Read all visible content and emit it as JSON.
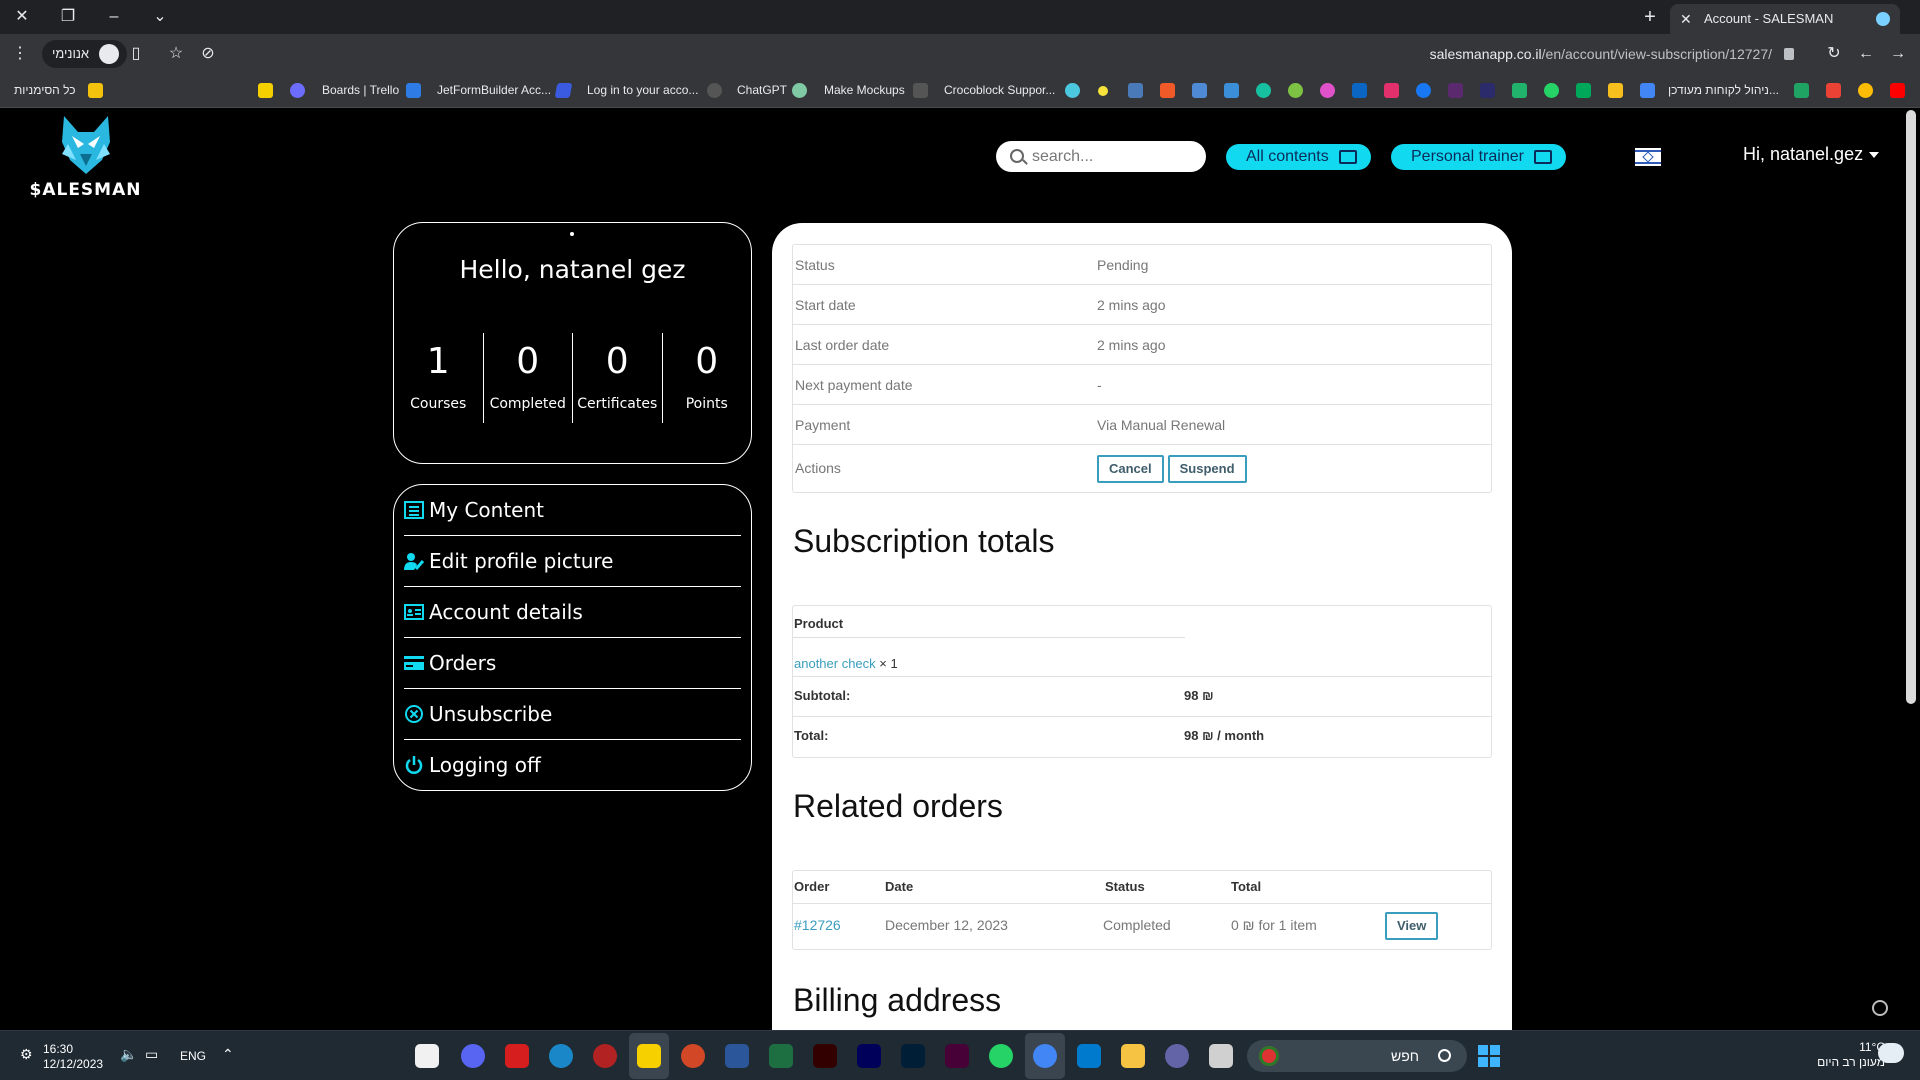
{
  "browser": {
    "tab_title": "Account - SALESMAN",
    "incognito_label": "אנונימי",
    "url_host": "salesmanapp.co.il",
    "url_path": "/en/account/view-subscription/12727/",
    "bookmarks": [
      "כל הסימניות",
      "Boards | Trello",
      "JetFormBuilder Acc...",
      "Log in to your acco...",
      "ChatGPT",
      "Make Mockups",
      "Crocoblock Suppor...",
      "ניהול לקוחות מעודכן..."
    ]
  },
  "site": {
    "logo_text": "$ALESMAN",
    "search_placeholder": "search...",
    "all_contents": "All contents",
    "personal_trainer": "Personal trainer",
    "user_greeting": "Hi, natanel.gez",
    "colors": {
      "accent": "#11d9f0",
      "link": "#3a9dbd"
    }
  },
  "profile": {
    "hello": "Hello, natanel gez",
    "stats": [
      {
        "value": "1",
        "label": "Courses"
      },
      {
        "value": "0",
        "label": "Completed"
      },
      {
        "value": "0",
        "label": "Certificates"
      },
      {
        "value": "0",
        "label": "Points"
      }
    ]
  },
  "menu": [
    {
      "label": "My Content",
      "icon": "list-icon"
    },
    {
      "label": "Edit profile picture",
      "icon": "user-edit-icon"
    },
    {
      "label": "Account details",
      "icon": "id-card-icon"
    },
    {
      "label": "Orders",
      "icon": "credit-card-icon"
    },
    {
      "label": "Unsubscribe",
      "icon": "circle-x-icon"
    },
    {
      "label": "Logging off",
      "icon": "power-icon"
    }
  ],
  "subscription": {
    "rows": [
      {
        "key": "Status",
        "value": "Pending"
      },
      {
        "key": "Start date",
        "value": "2 mins ago"
      },
      {
        "key": "Last order date",
        "value": "2 mins ago"
      },
      {
        "key": "Next payment date",
        "value": "-"
      },
      {
        "key": "Payment",
        "value": "Via Manual Renewal"
      }
    ],
    "actions_label": "Actions",
    "cancel_label": "Cancel",
    "suspend_label": "Suspend"
  },
  "totals": {
    "heading": "Subscription totals",
    "product_header": "Product",
    "product_name": "another check",
    "product_qty": " × 1",
    "subtotal_label": "Subtotal:",
    "subtotal_value": "98 ₪",
    "total_label": "Total:",
    "total_value": "98 ₪ / month"
  },
  "related_orders": {
    "heading": "Related orders",
    "headers": [
      "Order",
      "Date",
      "Status",
      "Total"
    ],
    "row": {
      "order": "#12726",
      "date": "December 12, 2023",
      "status": "Completed",
      "total": "0 ₪ for 1 item",
      "view_label": "View"
    }
  },
  "billing": {
    "heading": "Billing address"
  },
  "taskbar": {
    "time": "16:30",
    "date": "12/12/2023",
    "lang": "ENG",
    "search_text": "חפש",
    "temp": "11°C",
    "weather_desc": "מעונן רב היום"
  }
}
